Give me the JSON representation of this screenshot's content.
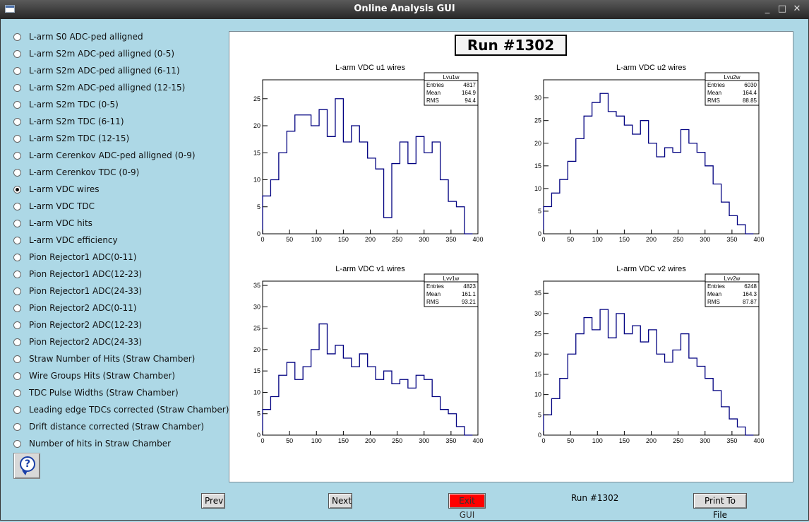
{
  "window": {
    "title": "Online Analysis GUI",
    "minimize": "_",
    "maximize": "□",
    "close": "✕"
  },
  "options": [
    {
      "label": "L-arm S0 ADC-ped alligned",
      "checked": false
    },
    {
      "label": "L-arm S2m ADC-ped alligned (0-5)",
      "checked": false
    },
    {
      "label": "L-arm S2m ADC-ped alligned (6-11)",
      "checked": false
    },
    {
      "label": "L-arm S2m ADC-ped alligned (12-15)",
      "checked": false
    },
    {
      "label": "L-arm S2m TDC (0-5)",
      "checked": false
    },
    {
      "label": "L-arm S2m TDC (6-11)",
      "checked": false
    },
    {
      "label": "L-arm S2m TDC (12-15)",
      "checked": false
    },
    {
      "label": "L-arm Cerenkov ADC-ped alligned (0-9)",
      "checked": false
    },
    {
      "label": "L-arm Cerenkov TDC (0-9)",
      "checked": false
    },
    {
      "label": "L-arm VDC wires",
      "checked": true
    },
    {
      "label": "L-arm VDC TDC",
      "checked": false
    },
    {
      "label": "L-arm VDC hits",
      "checked": false
    },
    {
      "label": "L-arm VDC efficiency",
      "checked": false
    },
    {
      "label": "Pion Rejector1 ADC(0-11)",
      "checked": false
    },
    {
      "label": "Pion Rejector1 ADC(12-23)",
      "checked": false
    },
    {
      "label": "Pion Rejector1 ADC(24-33)",
      "checked": false
    },
    {
      "label": "Pion Rejector2 ADC(0-11)",
      "checked": false
    },
    {
      "label": "Pion Rejector2 ADC(12-23)",
      "checked": false
    },
    {
      "label": "Pion Rejector2 ADC(24-33)",
      "checked": false
    },
    {
      "label": "Straw Number of Hits (Straw Chamber)",
      "checked": false
    },
    {
      "label": "Wire Groups Hits (Straw Chamber)",
      "checked": false
    },
    {
      "label": "TDC Pulse Widths (Straw Chamber)",
      "checked": false
    },
    {
      "label": "Leading edge TDCs corrected (Straw Chamber)",
      "checked": false
    },
    {
      "label": "Drift distance corrected (Straw Chamber)",
      "checked": false
    },
    {
      "label": "Number of hits in Straw Chamber",
      "checked": false
    }
  ],
  "help": {
    "icon": "help-icon",
    "glyph": "?"
  },
  "canvas": {
    "run_title": "Run #1302"
  },
  "buttons": {
    "prev": "Prev",
    "next": "Next",
    "exit": "Exit GUI",
    "print": "Print To File"
  },
  "status": {
    "run_label": "Run #1302"
  },
  "colors": {
    "histogram_line": "#000080",
    "background": "#add8e6",
    "exit_button": "#ff0000"
  },
  "chart_data": [
    {
      "type": "histogram",
      "title": "L-arm VDC u1 wires",
      "stats_name": "Lvu1w",
      "stats": [
        [
          "Entries",
          "4817"
        ],
        [
          "Mean",
          "164.9"
        ],
        [
          "RMS",
          "94.4"
        ]
      ],
      "xlim": [
        0,
        400
      ],
      "ylim": [
        0,
        28.5
      ],
      "xticks": [
        0,
        50,
        100,
        150,
        200,
        250,
        300,
        350,
        400
      ],
      "yticks": [
        0,
        5,
        10,
        15,
        20,
        25
      ],
      "x": [
        0,
        15,
        30,
        45,
        60,
        75,
        90,
        105,
        120,
        135,
        150,
        165,
        180,
        195,
        210,
        225,
        240,
        255,
        270,
        285,
        300,
        315,
        330,
        345,
        360,
        375
      ],
      "values": [
        7,
        10,
        15,
        19,
        22,
        22,
        20,
        23,
        18,
        25,
        17,
        20,
        17,
        14,
        12,
        3,
        13,
        17,
        13,
        18,
        15,
        17,
        10,
        6,
        5,
        0
      ]
    },
    {
      "type": "histogram",
      "title": "L-arm VDC u2 wires",
      "stats_name": "Lvu2w",
      "stats": [
        [
          "Entries",
          "6030"
        ],
        [
          "Mean",
          "164.4"
        ],
        [
          "RMS",
          "88.85"
        ]
      ],
      "xlim": [
        0,
        400
      ],
      "ylim": [
        0,
        34
      ],
      "xticks": [
        0,
        50,
        100,
        150,
        200,
        250,
        300,
        350,
        400
      ],
      "yticks": [
        0,
        5,
        10,
        15,
        20,
        25,
        30
      ],
      "x": [
        0,
        15,
        30,
        45,
        60,
        75,
        90,
        105,
        120,
        135,
        150,
        165,
        180,
        195,
        210,
        225,
        240,
        255,
        270,
        285,
        300,
        315,
        330,
        345,
        360,
        375
      ],
      "values": [
        6,
        9,
        12,
        16,
        21,
        26,
        29,
        31,
        27,
        26,
        24,
        22,
        25,
        20,
        17,
        19,
        18,
        23,
        20,
        18,
        15,
        11,
        7,
        4,
        2,
        0
      ]
    },
    {
      "type": "histogram",
      "title": "L-arm VDC v1 wires",
      "stats_name": "Lvv1w",
      "stats": [
        [
          "Entries",
          "4823"
        ],
        [
          "Mean",
          "161.1"
        ],
        [
          "RMS",
          "93.21"
        ]
      ],
      "xlim": [
        0,
        400
      ],
      "ylim": [
        0,
        36
      ],
      "xticks": [
        0,
        50,
        100,
        150,
        200,
        250,
        300,
        350,
        400
      ],
      "yticks": [
        0,
        5,
        10,
        15,
        20,
        25,
        30,
        35
      ],
      "x": [
        0,
        15,
        30,
        45,
        60,
        75,
        90,
        105,
        120,
        135,
        150,
        165,
        180,
        195,
        210,
        225,
        240,
        255,
        270,
        285,
        300,
        315,
        330,
        345,
        360,
        375
      ],
      "values": [
        6,
        9,
        14,
        17,
        13,
        16,
        20,
        26,
        19,
        21,
        18,
        16,
        19,
        16,
        13,
        15,
        12,
        13,
        11,
        14,
        13,
        9,
        6,
        5,
        2,
        0
      ]
    },
    {
      "type": "histogram",
      "title": "L-arm VDC v2 wires",
      "stats_name": "Lvv2w",
      "stats": [
        [
          "Entries",
          "6248"
        ],
        [
          "Mean",
          "164.3"
        ],
        [
          "RMS",
          "87.87"
        ]
      ],
      "xlim": [
        0,
        400
      ],
      "ylim": [
        0,
        38
      ],
      "xticks": [
        0,
        50,
        100,
        150,
        200,
        250,
        300,
        350,
        400
      ],
      "yticks": [
        0,
        5,
        10,
        15,
        20,
        25,
        30,
        35
      ],
      "x": [
        0,
        15,
        30,
        45,
        60,
        75,
        90,
        105,
        120,
        135,
        150,
        165,
        180,
        195,
        210,
        225,
        240,
        255,
        270,
        285,
        300,
        315,
        330,
        345,
        360,
        375
      ],
      "values": [
        5,
        9,
        14,
        20,
        25,
        29,
        26,
        31,
        24,
        30,
        25,
        27,
        23,
        26,
        20,
        18,
        21,
        25,
        19,
        17,
        14,
        11,
        7,
        4,
        2,
        0
      ]
    }
  ]
}
